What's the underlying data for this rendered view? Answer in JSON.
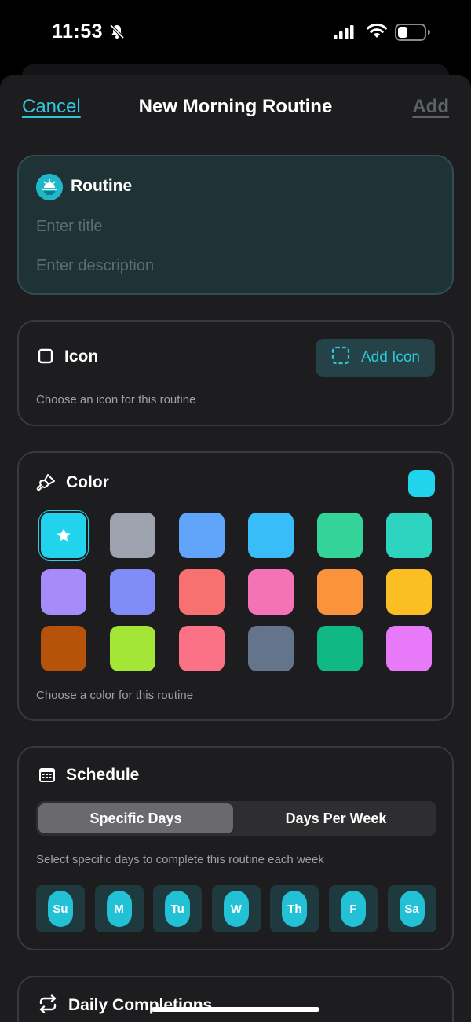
{
  "status_bar": {
    "time": "11:53",
    "icons": [
      "bell-slash-icon",
      "signal-icon",
      "wifi-icon",
      "battery-icon"
    ]
  },
  "nav": {
    "cancel_label": "Cancel",
    "title": "New Morning Routine",
    "add_label": "Add"
  },
  "routine": {
    "heading": "Routine",
    "badge_icon": "sunrise-icon",
    "title_placeholder": "Enter title",
    "description_placeholder": "Enter description"
  },
  "icon_section": {
    "heading": "Icon",
    "add_button_label": "Add Icon",
    "caption": "Choose an icon for this routine"
  },
  "color_section": {
    "heading": "Color",
    "selected_color": "#22d3ee",
    "caption": "Choose a color for this routine",
    "swatches": [
      "#22d3ee",
      "#9ca3af",
      "#60a5fa",
      "#38bdf8",
      "#34d399",
      "#2dd4bf",
      "#a78bfa",
      "#818cf8",
      "#f87171",
      "#f472b6",
      "#fb923c",
      "#fbbf24",
      "#b45309",
      "#a3e635",
      "#fb7185",
      "#64748b",
      "#10b981",
      "#e879f9"
    ]
  },
  "schedule": {
    "heading": "Schedule",
    "tabs": [
      "Specific Days",
      "Days Per Week"
    ],
    "active_tab": "Specific Days",
    "caption": "Select specific days to complete this routine each week",
    "days": [
      "Su",
      "M",
      "Tu",
      "W",
      "Th",
      "F",
      "Sa"
    ]
  },
  "daily_completions": {
    "heading": "Daily Completions"
  },
  "colors": {
    "accent": "#2ec7d8",
    "background": "#1d1d1f"
  }
}
